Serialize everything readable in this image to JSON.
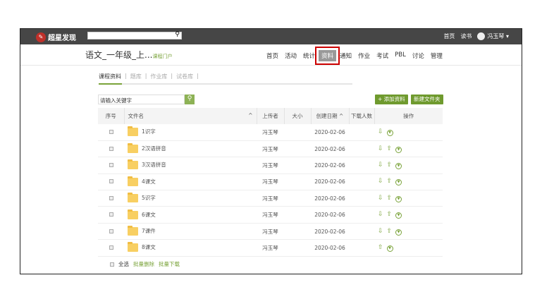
{
  "topbar": {
    "brand": "超星发现",
    "links": [
      "首页",
      "读书"
    ],
    "user": "冯玉琴"
  },
  "course": {
    "title": "语文_一年级_上...",
    "portal": "课程门户"
  },
  "nav": [
    "首页",
    "活动",
    "统计",
    "资料",
    "通知",
    "作业",
    "考试",
    "PBL",
    "讨论",
    "管理"
  ],
  "active_nav": "资料",
  "subtabs": [
    "课程资料",
    "题库",
    "作业库",
    "试卷库"
  ],
  "search": {
    "placeholder": "请输入关键字"
  },
  "buttons": {
    "add": "+ 添加资料",
    "new_folder": "新建文件夹"
  },
  "columns": [
    "序号",
    "文件名",
    "上传者",
    "大小",
    "创建日期",
    "下载人数",
    "操作"
  ],
  "rows": [
    {
      "name": "1识字",
      "uploader": "冯玉琴",
      "size": "",
      "date": "2020-02-06",
      "downloads": "",
      "ops": [
        "download",
        "more"
      ]
    },
    {
      "name": "2汉语拼音",
      "uploader": "冯玉琴",
      "size": "",
      "date": "2020-02-06",
      "downloads": "",
      "ops": [
        "download",
        "upload",
        "more"
      ]
    },
    {
      "name": "3汉语拼音",
      "uploader": "冯玉琴",
      "size": "",
      "date": "2020-02-06",
      "downloads": "",
      "ops": [
        "download",
        "upload",
        "more"
      ]
    },
    {
      "name": "4课文",
      "uploader": "冯玉琴",
      "size": "",
      "date": "2020-02-06",
      "downloads": "",
      "ops": [
        "download",
        "upload",
        "more"
      ]
    },
    {
      "name": "5识字",
      "uploader": "冯玉琴",
      "size": "",
      "date": "2020-02-06",
      "downloads": "",
      "ops": [
        "download",
        "upload",
        "more"
      ]
    },
    {
      "name": "6课文",
      "uploader": "冯玉琴",
      "size": "",
      "date": "2020-02-06",
      "downloads": "",
      "ops": [
        "download",
        "upload",
        "more"
      ]
    },
    {
      "name": "7课件",
      "uploader": "冯玉琴",
      "size": "",
      "date": "2020-02-06",
      "downloads": "",
      "ops": [
        "download",
        "upload",
        "more"
      ]
    },
    {
      "name": "8课文",
      "uploader": "冯玉琴",
      "size": "",
      "date": "2020-02-06",
      "downloads": "",
      "ops": [
        "upload",
        "more"
      ]
    }
  ],
  "footer": {
    "select_all": "全选",
    "batch_delete": "批量删除",
    "batch_download": "批量下载"
  }
}
